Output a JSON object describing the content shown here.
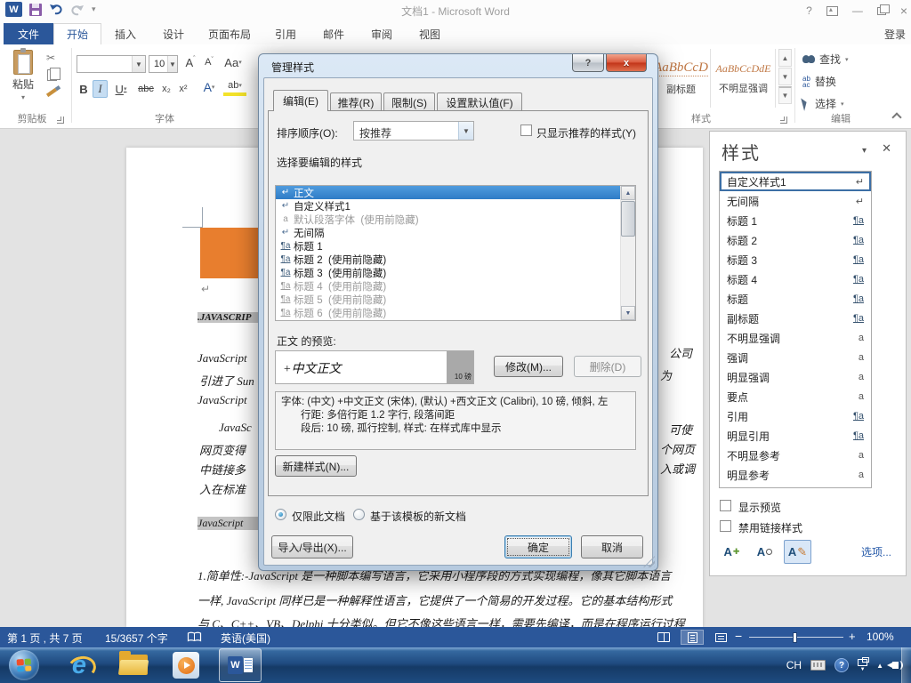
{
  "window": {
    "title": "文档1 - Microsoft Word",
    "signin": "登录",
    "help": "?"
  },
  "tabs": {
    "file": "文件",
    "items": [
      "开始",
      "插入",
      "设计",
      "页面布局",
      "引用",
      "邮件",
      "审阅",
      "视图"
    ]
  },
  "ribbon": {
    "paste": "粘贴",
    "clipboard_group": "剪贴板",
    "font_group": "字体",
    "font_size": "10",
    "bold": "B",
    "italic": "I",
    "underline": "U",
    "strike": "abc",
    "sub": "x₂",
    "sup": "x²",
    "grow": "A",
    "shrink": "A",
    "case": "Aa",
    "effects": "A",
    "highlight": "ab",
    "gallery": [
      {
        "sample": "AaBbCcD",
        "name": "副标题"
      },
      {
        "sample": "AaBbCcDdE",
        "name": "不明显强调"
      }
    ],
    "styles_group": "样式",
    "find": "查找",
    "replace": "替换",
    "select": "选择",
    "edit_group": "编辑"
  },
  "dialog": {
    "title": "管理样式",
    "tabs": [
      "编辑(E)",
      "推荐(R)",
      "限制(S)",
      "设置默认值(F)"
    ],
    "sort_label": "排序顺序(O):",
    "sort_value": "按推荐",
    "only_recommended": "只显示推荐的样式(Y)",
    "select_label": "选择要编辑的样式",
    "styles": [
      {
        "glyph": "↵",
        "name": "正文",
        "suffix": ""
      },
      {
        "glyph": "↵",
        "name": "自定义样式1",
        "suffix": ""
      },
      {
        "glyph": "a",
        "name": "默认段落字体",
        "suffix": "(使用前隐藏)"
      },
      {
        "glyph": "↵",
        "name": "无间隔",
        "suffix": ""
      },
      {
        "glyph": "¶a",
        "name": "标题 1",
        "suffix": ""
      },
      {
        "glyph": "¶a",
        "name": "标题 2",
        "suffix": "(使用前隐藏)"
      },
      {
        "glyph": "¶a",
        "name": "标题 3",
        "suffix": "(使用前隐藏)"
      },
      {
        "glyph": "¶a",
        "name": "标题 4",
        "suffix": "(使用前隐藏)"
      },
      {
        "glyph": "¶a",
        "name": "标题 5",
        "suffix": "(使用前隐藏)"
      },
      {
        "glyph": "¶a",
        "name": "标题 6",
        "suffix": "(使用前隐藏)"
      }
    ],
    "preview_label": "正文 的预览:",
    "preview_text": "+中文正文",
    "preview_size": "10 磅",
    "modify": "修改(M)...",
    "delete": "删除(D)",
    "desc1": "字体: (中文) +中文正文 (宋体), (默认) +西文正文 (Calibri), 10 磅, 倾斜, 左",
    "desc2": "行距: 多倍行距 1.2 字行, 段落间距",
    "desc3": "段后: 10 磅, 孤行控制, 样式: 在样式库中显示",
    "new_style": "新建样式(N)...",
    "radio_doc": "仅限此文档",
    "radio_template": "基于该模板的新文档",
    "import_export": "导入/导出(X)...",
    "ok": "确定",
    "cancel": "取消"
  },
  "pane": {
    "title": "样式",
    "styles": [
      {
        "name": "自定义样式1",
        "glyph": "↵"
      },
      {
        "name": "无间隔",
        "glyph": "↵"
      },
      {
        "name": "标题 1",
        "glyph": "¶a"
      },
      {
        "name": "标题 2",
        "glyph": "¶a"
      },
      {
        "name": "标题 3",
        "glyph": "¶a"
      },
      {
        "name": "标题 4",
        "glyph": "¶a"
      },
      {
        "name": "标题",
        "glyph": "¶a"
      },
      {
        "name": "副标题",
        "glyph": "¶a"
      },
      {
        "name": "不明显强调",
        "glyph": "a"
      },
      {
        "name": "强调",
        "glyph": "a"
      },
      {
        "name": "明显强调",
        "glyph": "a"
      },
      {
        "name": "要点",
        "glyph": "a"
      },
      {
        "name": "引用",
        "glyph": "¶a"
      },
      {
        "name": "明显引用",
        "glyph": "¶a"
      },
      {
        "name": "不明显参考",
        "glyph": "a"
      },
      {
        "name": "明显参考",
        "glyph": "a"
      }
    ],
    "show_preview": "显示预览",
    "disable_linked": "禁用链接样式",
    "options": "选项..."
  },
  "doc": {
    "left": [
      ".JAVASCRIP",
      "JavaScript",
      "引进了 Sun",
      "JavaScript",
      "JavaSc",
      "网页变得",
      "中链接多",
      "入在标准",
      "JavaScript"
    ],
    "right": [
      "公司",
      "为",
      "可使",
      "个网页",
      "入或调"
    ],
    "lines": [
      "1.简单性:-JavaScript 是一种脚本编写语言，它采用小程序段的方式实现编程，像其它脚本语言",
      "一样, JavaScript 同样已是一种解释性语言，它提供了一个简易的开发过程。它的基本结构形式",
      "与 C、C++、VB、Delphi 十分类似。但它不像这些语言一样，需要先编译，而是在程序运行过程"
    ]
  },
  "status": {
    "page": "第 1 页 , 共 7 页",
    "words": "15/3657 个字",
    "lang": "英语(美国)",
    "zoom": "100%"
  },
  "tray": {
    "lang": "CH"
  }
}
